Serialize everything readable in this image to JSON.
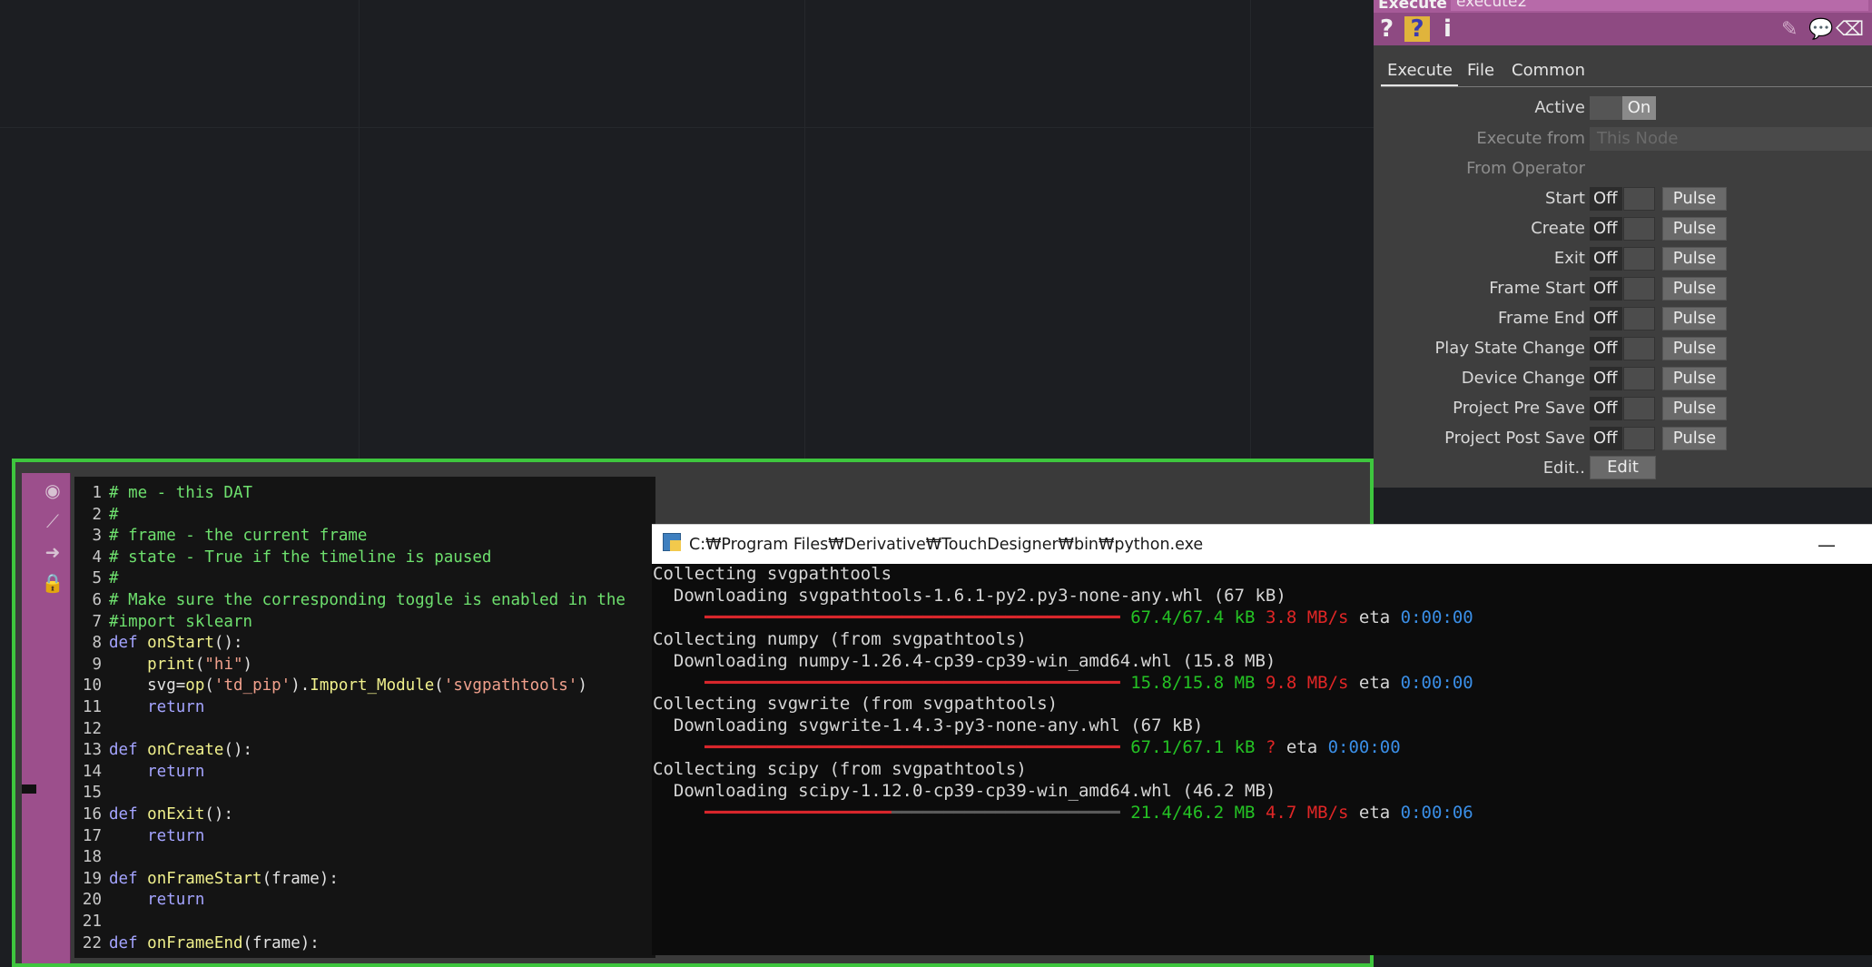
{
  "dat": {
    "lines": [
      {
        "num": "1",
        "parts": [
          {
            "t": "# me - this DAT",
            "c": "com"
          }
        ]
      },
      {
        "num": "2",
        "parts": [
          {
            "t": "#",
            "c": "com"
          }
        ]
      },
      {
        "num": "3",
        "parts": [
          {
            "t": "# frame - the current frame",
            "c": "com"
          }
        ]
      },
      {
        "num": "4",
        "parts": [
          {
            "t": "# state - True if the timeline is paused",
            "c": "com"
          }
        ]
      },
      {
        "num": "5",
        "parts": [
          {
            "t": "#",
            "c": "com"
          }
        ]
      },
      {
        "num": "6",
        "parts": [
          {
            "t": "# Make sure the corresponding toggle is enabled in the",
            "c": "com"
          }
        ]
      },
      {
        "num": "7",
        "parts": [
          {
            "t": "#import sklearn",
            "c": "com"
          }
        ]
      },
      {
        "num": "8",
        "parts": [
          {
            "t": "def ",
            "c": "kw"
          },
          {
            "t": "onStart",
            "c": "fn"
          },
          {
            "t": "():",
            "c": "txt"
          }
        ]
      },
      {
        "num": "9",
        "parts": [
          {
            "t": "    ",
            "c": "txt"
          },
          {
            "t": "print",
            "c": "fn"
          },
          {
            "t": "(",
            "c": "txt"
          },
          {
            "t": "\"hi\"",
            "c": "str"
          },
          {
            "t": ")",
            "c": "txt"
          }
        ]
      },
      {
        "num": "10",
        "parts": [
          {
            "t": "    svg=",
            "c": "txt"
          },
          {
            "t": "op",
            "c": "fn"
          },
          {
            "t": "(",
            "c": "txt"
          },
          {
            "t": "'td_pip'",
            "c": "str"
          },
          {
            "t": ").",
            "c": "txt"
          },
          {
            "t": "Import_Module",
            "c": "fn"
          },
          {
            "t": "(",
            "c": "txt"
          },
          {
            "t": "'svgpathtools'",
            "c": "str"
          },
          {
            "t": ")",
            "c": "txt"
          }
        ]
      },
      {
        "num": "11",
        "parts": [
          {
            "t": "    return",
            "c": "kw"
          }
        ]
      },
      {
        "num": "12",
        "parts": []
      },
      {
        "num": "13",
        "parts": [
          {
            "t": "def ",
            "c": "kw"
          },
          {
            "t": "onCreate",
            "c": "fn"
          },
          {
            "t": "():",
            "c": "txt"
          }
        ]
      },
      {
        "num": "14",
        "parts": [
          {
            "t": "    return",
            "c": "kw"
          }
        ]
      },
      {
        "num": "15",
        "parts": []
      },
      {
        "num": "16",
        "parts": [
          {
            "t": "def ",
            "c": "kw"
          },
          {
            "t": "onExit",
            "c": "fn"
          },
          {
            "t": "():",
            "c": "txt"
          }
        ]
      },
      {
        "num": "17",
        "parts": [
          {
            "t": "    return",
            "c": "kw"
          }
        ]
      },
      {
        "num": "18",
        "parts": []
      },
      {
        "num": "19",
        "parts": [
          {
            "t": "def ",
            "c": "kw"
          },
          {
            "t": "onFrameStart",
            "c": "fn"
          },
          {
            "t": "(frame):",
            "c": "txt"
          }
        ]
      },
      {
        "num": "20",
        "parts": [
          {
            "t": "    return",
            "c": "kw"
          }
        ]
      },
      {
        "num": "21",
        "parts": []
      },
      {
        "num": "22",
        "parts": [
          {
            "t": "def ",
            "c": "kw"
          },
          {
            "t": "onFrameEnd",
            "c": "fn"
          },
          {
            "t": "(frame):",
            "c": "txt"
          }
        ]
      }
    ]
  },
  "params": {
    "op_type": "Execute",
    "op_name": "execute2",
    "header_icons": {
      "help": "?",
      "python_help": "?",
      "info": "i"
    },
    "tabs": [
      "Execute",
      "File",
      "Common"
    ],
    "active_label": "Active",
    "active_value": "On",
    "execute_from_label": "Execute from",
    "execute_from_value": "This Node",
    "from_operator_label": "From Operator",
    "toggle_rows": [
      {
        "label": "Start",
        "value": "Off",
        "button": "Pulse"
      },
      {
        "label": "Create",
        "value": "Off",
        "button": "Pulse"
      },
      {
        "label": "Exit",
        "value": "Off",
        "button": "Pulse"
      },
      {
        "label": "Frame Start",
        "value": "Off",
        "button": "Pulse"
      },
      {
        "label": "Frame End",
        "value": "Off",
        "button": "Pulse"
      },
      {
        "label": "Play State Change",
        "value": "Off",
        "button": "Pulse"
      },
      {
        "label": "Device Change",
        "value": "Off",
        "button": "Pulse"
      },
      {
        "label": "Project Pre Save",
        "value": "Off",
        "button": "Pulse"
      },
      {
        "label": "Project Post Save",
        "value": "Off",
        "button": "Pulse"
      }
    ],
    "edit_label": "Edit..",
    "edit_button": "Edit"
  },
  "console": {
    "title": "C:₩Program Files₩Derivative₩TouchDesigner₩bin₩python.exe",
    "minimize": "—",
    "lines": [
      [
        {
          "t": "Collecting svgpathtools",
          "c": "w"
        }
      ],
      [
        {
          "t": "  Downloading svgpathtools-1.6.1-py2.py3-none-any.whl (67 kB)",
          "c": "w"
        }
      ],
      [
        {
          "t": "     ━━━━━━━━━━━━━━━━━━━━━━━━━━━━━━━━━━━━━━━━ ",
          "c": "bar-red"
        },
        {
          "t": "67.4/67.4 kB",
          "c": "g"
        },
        {
          "t": " ",
          "c": "w"
        },
        {
          "t": "3.8 MB/s",
          "c": "r"
        },
        {
          "t": " eta ",
          "c": "w"
        },
        {
          "t": "0:00:00",
          "c": "b"
        }
      ],
      [
        {
          "t": "Collecting numpy (from svgpathtools)",
          "c": "w"
        }
      ],
      [
        {
          "t": "  Downloading numpy-1.26.4-cp39-cp39-win_amd64.whl (15.8 MB)",
          "c": "w"
        }
      ],
      [
        {
          "t": "     ━━━━━━━━━━━━━━━━━━━━━━━━━━━━━━━━━━━━━━━━ ",
          "c": "bar-red"
        },
        {
          "t": "15.8/15.8 MB",
          "c": "g"
        },
        {
          "t": " ",
          "c": "w"
        },
        {
          "t": "9.8 MB/s",
          "c": "r"
        },
        {
          "t": " eta ",
          "c": "w"
        },
        {
          "t": "0:00:00",
          "c": "b"
        }
      ],
      [
        {
          "t": "Collecting svgwrite (from svgpathtools)",
          "c": "w"
        }
      ],
      [
        {
          "t": "  Downloading svgwrite-1.4.3-py3-none-any.whl (67 kB)",
          "c": "w"
        }
      ],
      [
        {
          "t": "     ━━━━━━━━━━━━━━━━━━━━━━━━━━━━━━━━━━━━━━━━ ",
          "c": "bar-red"
        },
        {
          "t": "67.1/67.1 kB",
          "c": "g"
        },
        {
          "t": " ",
          "c": "w"
        },
        {
          "t": "?",
          "c": "r"
        },
        {
          "t": " eta ",
          "c": "w"
        },
        {
          "t": "0:00:00",
          "c": "b"
        }
      ],
      [
        {
          "t": "Collecting scipy (from svgpathtools)",
          "c": "w"
        }
      ],
      [
        {
          "t": "  Downloading scipy-1.12.0-cp39-cp39-win_amd64.whl (46.2 MB)",
          "c": "w"
        }
      ],
      [
        {
          "t": "     ━━━━━━━━━━━━━━━━━━",
          "c": "bar-red"
        },
        {
          "t": "━━━━━━━━━━━━━━━━━━━━━━ ",
          "c": "bar-dk"
        },
        {
          "t": "21.4/46.2 MB",
          "c": "g"
        },
        {
          "t": " ",
          "c": "w"
        },
        {
          "t": "4.7 MB/s",
          "c": "r"
        },
        {
          "t": " eta ",
          "c": "w"
        },
        {
          "t": "0:00:06",
          "c": "b"
        }
      ]
    ]
  }
}
